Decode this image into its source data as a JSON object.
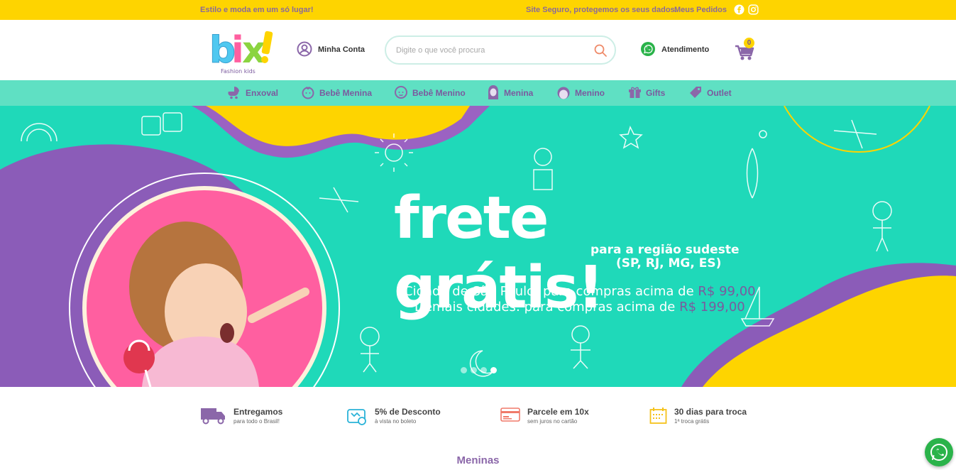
{
  "topbar": {
    "tagline": "Estilo e moda em um só lugar!",
    "secure": "Site Seguro, protegemos os seus dados.",
    "orders": "Meus Pedidos"
  },
  "header": {
    "logo_text": "bix!",
    "logo_sub": "Fashion kids",
    "account_label": "Minha Conta",
    "search_placeholder": "Digite o que você procura",
    "support_label": "Atendimento",
    "cart_count": "0"
  },
  "nav": {
    "items": [
      {
        "label": "Enxoval",
        "icon": "stroller-icon"
      },
      {
        "label": "Bebê Menina",
        "icon": "baby-girl-icon"
      },
      {
        "label": "Bebê Menino",
        "icon": "baby-boy-icon"
      },
      {
        "label": "Menina",
        "icon": "girl-icon"
      },
      {
        "label": "Menino",
        "icon": "boy-icon"
      },
      {
        "label": "Gifts",
        "icon": "gift-icon"
      },
      {
        "label": "Outlet",
        "icon": "tag-icon"
      }
    ]
  },
  "banner": {
    "headline": "frete grátis!",
    "sub1": "para a região sudeste",
    "sub2": "(SP, RJ, MG, ES)",
    "line1_prefix": "Cidade de São Paulo: para compras acima de ",
    "line1_price": "R$ 99,00",
    "line2_prefix": "Demais cidades: para compras acima de ",
    "line2_price": "R$ 199,00",
    "slides": 4,
    "active_slide": 4
  },
  "features": [
    {
      "title": "Entregamos",
      "desc": "para todo o Brasil!",
      "icon": "truck-icon"
    },
    {
      "title": "5% de Desconto",
      "desc": "à vista no boleto",
      "icon": "discount-icon"
    },
    {
      "title": "Parcele em 10x",
      "desc": "sem juros no cartão",
      "icon": "credit-card-icon"
    },
    {
      "title": "30 dias para troca",
      "desc": "1ª troca grátis",
      "icon": "calendar-icon"
    }
  ],
  "section_title": "Meninas",
  "colors": {
    "yellow": "#fed400",
    "teal": "#1fd9b9",
    "nav_teal": "#5fe0c3",
    "purple": "#7b5a9e",
    "pink": "#ff5fa0",
    "whatsapp": "#2ab34a"
  }
}
